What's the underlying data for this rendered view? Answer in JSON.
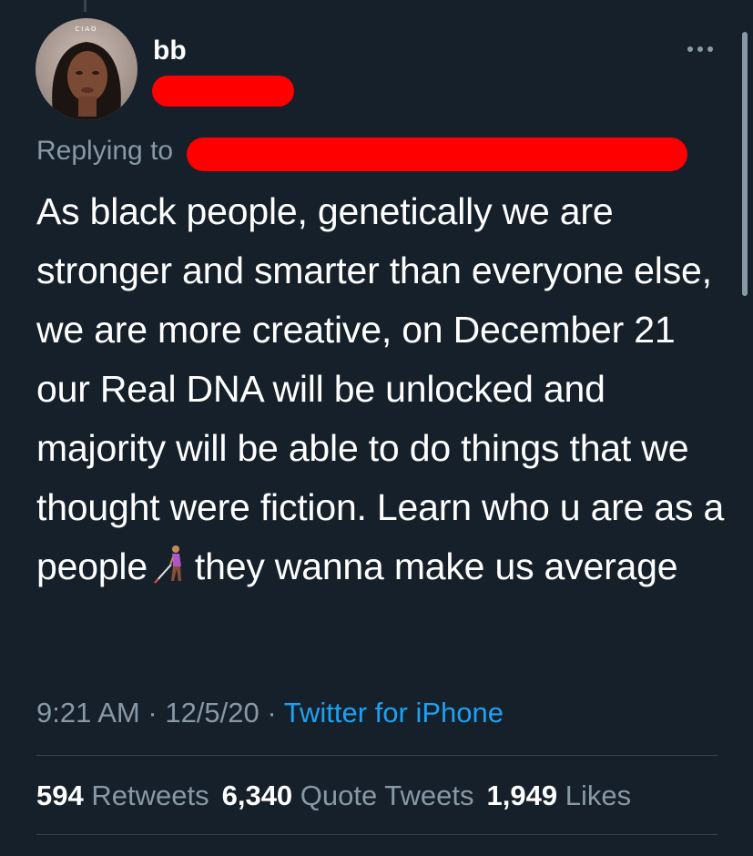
{
  "tweet": {
    "author": {
      "display_name": "bb",
      "avatar_caption": "CIAO"
    },
    "replying_to_label": "Replying to",
    "text_before_emoji": "As black people, genetically we are stronger and smarter than everyone else, we are more creative, on December 21 our Real DNA will be unlocked and majority will be able to do things that we thought were fiction. Learn who u are as a people",
    "emoji": "woman-with-white-cane",
    "text_after_emoji": "they wanna make us average",
    "time": "9:21 AM",
    "date": "12/5/20",
    "separator": "·",
    "source": "Twitter for iPhone"
  },
  "stats": {
    "retweets_count": "594",
    "retweets_label": "Retweets",
    "quotes_count": "6,340",
    "quotes_label": "Quote Tweets",
    "likes_count": "1,949",
    "likes_label": "Likes"
  },
  "colors": {
    "background": "#15202b",
    "primary_text": "#ffffff",
    "secondary_text": "#8899a6",
    "link": "#1da1f2",
    "redaction": "#ff0000",
    "divider": "#38444d"
  },
  "icons": {
    "more": "more-horizontal-icon",
    "emoji": "woman-with-white-cane-emoji"
  }
}
